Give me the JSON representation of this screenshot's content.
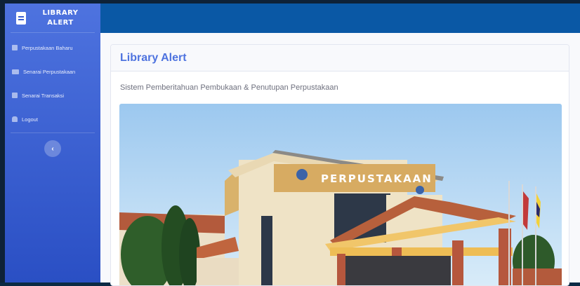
{
  "sidebar": {
    "brand_line1": "LIBRARY",
    "brand_line2": "ALERT",
    "brand_icon": "book-icon",
    "items": [
      {
        "label": "Perpustakaan Baharu",
        "icon": "book-icon"
      },
      {
        "label": "Senarai Perpustakaan",
        "icon": "library-icon"
      },
      {
        "label": "Senarai Transaksi",
        "icon": "table-icon"
      },
      {
        "label": "Logout",
        "icon": "user-icon"
      }
    ],
    "toggle_label": "‹"
  },
  "main": {
    "card_title": "Library Alert",
    "subtitle": "Sistem Pemberitahuan Pembukaan & Penutupan Perpustakaan",
    "photo_sign": "PERPUSTAKAAN"
  },
  "colors": {
    "sidebar": "#4e73df",
    "topbar": "#0a58a5",
    "accent": "#4e73df"
  }
}
